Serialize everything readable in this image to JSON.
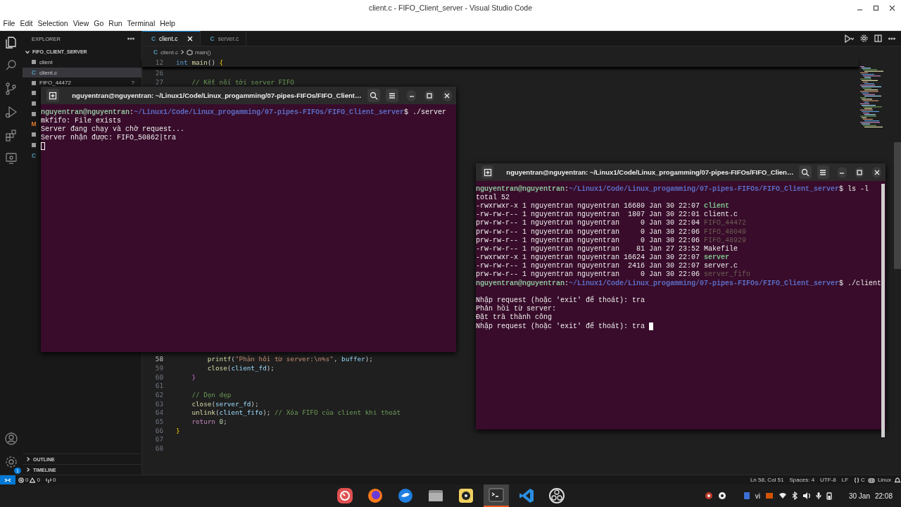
{
  "window": {
    "title": "client.c - FIFO_Client_server - Visual Studio Code"
  },
  "menu": [
    "File",
    "Edit",
    "Selection",
    "View",
    "Go",
    "Run",
    "Terminal",
    "Help"
  ],
  "activity_bar": [
    {
      "kind": "explorer",
      "selected": true
    },
    {
      "kind": "search",
      "selected": false
    },
    {
      "kind": "source-control",
      "selected": false
    },
    {
      "kind": "run",
      "selected": false
    },
    {
      "kind": "extensions",
      "selected": false
    },
    {
      "kind": "remote",
      "selected": false
    }
  ],
  "settings_badge": "1",
  "sidebar": {
    "title": "EXPLORER",
    "folder": {
      "label": "FIFO_CLIENT_SERVER",
      "expanded": true,
      "children": [
        {
          "kind": "binary",
          "label": "client",
          "selected": false
        },
        {
          "kind": "c",
          "glyph": "C",
          "label": "client.c",
          "selected": true
        },
        {
          "kind": "binary",
          "label": "FIFO_44472",
          "badge": "?",
          "selected": false
        },
        {
          "kind": "binary",
          "selected": false
        },
        {
          "kind": "binary",
          "selected": false
        },
        {
          "kind": "binary",
          "selected": false
        },
        {
          "kind": "makefile",
          "glyph": "M",
          "selected": false
        },
        {
          "kind": "binary",
          "selected": false
        },
        {
          "kind": "binary",
          "selected": false
        },
        {
          "kind": "c",
          "glyph": "C",
          "selected": false
        }
      ]
    },
    "sections": [
      {
        "label": "OUTLINE",
        "expanded": false
      },
      {
        "label": "TIMELINE",
        "expanded": false
      }
    ]
  },
  "tabs": [
    {
      "glyph": "C",
      "label": "client.c",
      "selected": true
    },
    {
      "glyph": "C",
      "label": "server.c",
      "selected": false
    }
  ],
  "breadcrumb": {
    "glyph": "C",
    "file": "client.c",
    "symbol": "main()"
  },
  "sticky_line": {
    "number": "12",
    "tokens": [
      {
        "kind": "type",
        "text": "int "
      },
      {
        "kind": "fn",
        "text": "main"
      },
      {
        "kind": "plain",
        "text": "() "
      },
      {
        "kind": "bracket1",
        "text": "{"
      }
    ]
  },
  "code_lines": [
    {
      "number": "26",
      "current": false
    },
    {
      "number": "27",
      "current": false,
      "kind": "level1",
      "tokens": [
        {
          "kind": "comment",
          "text": "// Kết nối tới server FIFO"
        }
      ]
    },
    {
      "number": "58",
      "current": true,
      "kind": "level2",
      "tokens": [
        {
          "kind": "fn",
          "text": "printf"
        },
        {
          "kind": "plain",
          "text": "("
        },
        {
          "kind": "str",
          "text": "\"Phản hồi từ server:\\n%s\""
        },
        {
          "kind": "plain",
          "text": ", "
        },
        {
          "kind": "var",
          "text": "buffer"
        },
        {
          "kind": "plain",
          "text": ");"
        }
      ]
    },
    {
      "number": "59",
      "current": false,
      "kind": "level2",
      "tokens": [
        {
          "kind": "fn",
          "text": "close"
        },
        {
          "kind": "plain",
          "text": "("
        },
        {
          "kind": "var",
          "text": "client_fd"
        },
        {
          "kind": "plain",
          "text": ");"
        }
      ]
    },
    {
      "number": "60",
      "current": false,
      "kind": "level1",
      "tokens": [
        {
          "kind": "bracket2",
          "text": "}"
        }
      ]
    },
    {
      "number": "61",
      "current": false
    },
    {
      "number": "62",
      "current": false,
      "kind": "level1",
      "tokens": [
        {
          "kind": "comment",
          "text": "// Dọn dẹp"
        }
      ]
    },
    {
      "number": "63",
      "current": false,
      "kind": "level1",
      "tokens": [
        {
          "kind": "fn",
          "text": "close"
        },
        {
          "kind": "plain",
          "text": "("
        },
        {
          "kind": "var",
          "text": "server_fd"
        },
        {
          "kind": "plain",
          "text": ");"
        }
      ]
    },
    {
      "number": "64",
      "current": false,
      "kind": "level1",
      "tokens": [
        {
          "kind": "fn",
          "text": "unlink"
        },
        {
          "kind": "plain",
          "text": "("
        },
        {
          "kind": "var",
          "text": "client_fifo"
        },
        {
          "kind": "plain",
          "text": "); "
        },
        {
          "kind": "comment",
          "text": "// Xóa FIFO của client khi thoát"
        }
      ]
    },
    {
      "number": "65",
      "current": false,
      "kind": "level1",
      "tokens": [
        {
          "kind": "ctrl",
          "text": "return "
        },
        {
          "kind": "num",
          "text": "0"
        },
        {
          "kind": "plain",
          "text": ";"
        }
      ]
    },
    {
      "number": "66",
      "current": false,
      "tokens": [
        {
          "kind": "bracket1",
          "text": "}"
        }
      ]
    },
    {
      "number": "67",
      "current": false
    },
    {
      "number": "68",
      "current": false
    }
  ],
  "terminals": [
    {
      "title": "nguyentran@nguyentran: ~/Linux1/Code/Linux_progamming/07-pipes-FIFOs/FIFO_Client…",
      "focused": false,
      "lines": [
        {
          "segments": [
            {
              "kind": "user",
              "text": "nguyentran@nguyentran"
            },
            {
              "kind": "plain",
              "text": ":"
            },
            {
              "kind": "path",
              "text": "~/Linux1/Code/Linux_progamming/07-pipes-FIFOs/FIFO_Client_server"
            },
            {
              "kind": "plain",
              "text": "$ ./server"
            }
          ]
        },
        {
          "segments": [
            {
              "kind": "plain",
              "text": "mkfifo: File exists"
            }
          ]
        },
        {
          "segments": [
            {
              "kind": "plain",
              "text": "Server đang chạy và chờ request..."
            }
          ]
        },
        {
          "segments": [
            {
              "kind": "plain",
              "text": "Server nhận được: FIFO_50862|tra"
            }
          ]
        },
        {
          "kind": "blank",
          "cursor": true
        }
      ]
    },
    {
      "title": "nguyentran@nguyentran: ~/Linux1/Code/Linux_progamming/07-pipes-FIFOs/FIFO_Clien…",
      "focused": true,
      "lines": [
        {
          "segments": [
            {
              "kind": "user",
              "text": "nguyentran@nguyentran"
            },
            {
              "kind": "plain",
              "text": ":"
            },
            {
              "kind": "path",
              "text": "~/Linux1/Code/Linux_progamming/07-pipes-FIFOs/FIFO_Client_server"
            },
            {
              "kind": "plain",
              "text": "$ ls -l"
            }
          ]
        },
        {
          "segments": [
            {
              "kind": "plain",
              "text": "total 52"
            }
          ]
        },
        {
          "segments": [
            {
              "kind": "plain",
              "text": "-rwxrwxr-x 1 nguyentran nguyentran 16680 Jan 30 22:07 "
            },
            {
              "kind": "exec",
              "text": "client"
            }
          ]
        },
        {
          "segments": [
            {
              "kind": "plain",
              "text": "-rw-rw-r-- 1 nguyentran nguyentran  1807 Jan 30 22:01 client.c"
            }
          ]
        },
        {
          "segments": [
            {
              "kind": "plain",
              "text": "prw-rw-r-- 1 nguyentran nguyentran     0 Jan 30 22:04 "
            },
            {
              "kind": "pipe",
              "text": "FIFO_44472"
            }
          ]
        },
        {
          "segments": [
            {
              "kind": "plain",
              "text": "prw-rw-r-- 1 nguyentran nguyentran     0 Jan 30 22:06 "
            },
            {
              "kind": "pipe",
              "text": "FIFO_48049"
            }
          ]
        },
        {
          "segments": [
            {
              "kind": "plain",
              "text": "prw-rw-r-- 1 nguyentran nguyentran     0 Jan 30 22:06 "
            },
            {
              "kind": "pipe",
              "text": "FIFO_48929"
            }
          ]
        },
        {
          "segments": [
            {
              "kind": "plain",
              "text": "-rw-rw-r-- 1 nguyentran nguyentran    81 Jan 27 23:52 Makefile"
            }
          ]
        },
        {
          "segments": [
            {
              "kind": "plain",
              "text": "-rwxrwxr-x 1 nguyentran nguyentran 16624 Jan 30 22:07 "
            },
            {
              "kind": "exec",
              "text": "server"
            }
          ]
        },
        {
          "segments": [
            {
              "kind": "plain",
              "text": "-rw-rw-r-- 1 nguyentran nguyentran  2416 Jan 30 22:07 server.c"
            }
          ]
        },
        {
          "segments": [
            {
              "kind": "plain",
              "text": "prw-rw-r-- 1 nguyentran nguyentran     0 Jan 30 22:06 "
            },
            {
              "kind": "pipe",
              "text": "server_fifo"
            }
          ]
        },
        {
          "segments": [
            {
              "kind": "user",
              "text": "nguyentran@nguyentran"
            },
            {
              "kind": "plain",
              "text": ":"
            },
            {
              "kind": "path",
              "text": "~/Linux1/Code/Linux_progamming/07-pipes-FIFOs/FIFO_Client_server"
            },
            {
              "kind": "plain",
              "text": "$ ./client"
            }
          ]
        },
        {
          "kind": "blank"
        },
        {
          "segments": [
            {
              "kind": "plain",
              "text": "Nhập request (hoặc 'exit' để thoát): tra"
            }
          ]
        },
        {
          "segments": [
            {
              "kind": "plain",
              "text": "Phản hồi từ server:"
            }
          ]
        },
        {
          "segments": [
            {
              "kind": "plain",
              "text": "Đặt trà thành công"
            }
          ]
        },
        {
          "segments": [
            {
              "kind": "plain",
              "text": "Nhập request (hoặc 'exit' để thoát): tra"
            }
          ],
          "cursor": true
        }
      ]
    }
  ],
  "status_bar": {
    "errors": "0",
    "warnings": "0",
    "ports": "0",
    "items": [
      "Ln 58, Col 51",
      "Spaces: 4",
      "UTF-8",
      "LF"
    ],
    "language": "C",
    "platform": "Linux"
  },
  "taskbar": {
    "apps": [
      {
        "kind": "dial",
        "selected": false
      },
      {
        "kind": "browser",
        "selected": false
      },
      {
        "kind": "mail",
        "selected": false
      },
      {
        "kind": "files",
        "selected": false
      },
      {
        "kind": "music",
        "selected": false
      },
      {
        "kind": "terminal",
        "selected": true
      },
      {
        "kind": "editor",
        "selected": false
      },
      {
        "kind": "recorder",
        "selected": false
      }
    ],
    "keyboard": "vi",
    "date": "30 Jan",
    "time": "22:08"
  }
}
